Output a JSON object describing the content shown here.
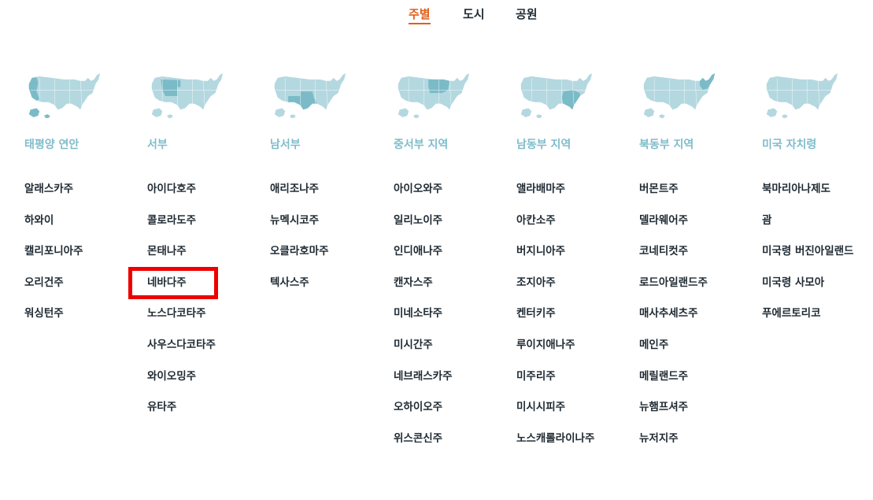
{
  "tabs": [
    {
      "label": "주별",
      "active": true
    },
    {
      "label": "도시",
      "active": false
    },
    {
      "label": "공원",
      "active": false
    }
  ],
  "colors": {
    "active_tab": "#e05f1a",
    "tab_text": "#1f2a33",
    "region_title": "#7fbccb",
    "map_base": "#b4d8e0",
    "map_highlight": "#7bbbc7",
    "selection_box": "#ee0000"
  },
  "regions": [
    {
      "title": "태평양 연안",
      "map_icon": "us-map-pacific-icon",
      "states": [
        "알래스카주",
        "하와이",
        "캘리포니아주",
        "오리건주",
        "워싱턴주"
      ]
    },
    {
      "title": "서부",
      "map_icon": "us-map-west-icon",
      "states": [
        "아이다호주",
        "콜로라도주",
        "몬태나주",
        "네바다주",
        "노스다코타주",
        "사우스다코타주",
        "와이오밍주",
        "유타주"
      ]
    },
    {
      "title": "남서부",
      "map_icon": "us-map-southwest-icon",
      "states": [
        "애리조나주",
        "뉴멕시코주",
        "오클라호마주",
        "텍사스주"
      ]
    },
    {
      "title": "중서부 지역",
      "map_icon": "us-map-midwest-icon",
      "states": [
        "아이오와주",
        "일리노이주",
        "인디애나주",
        "캔자스주",
        "미네소타주",
        "미시간주",
        "네브래스카주",
        "오하이오주",
        "위스콘신주"
      ]
    },
    {
      "title": "남동부 지역",
      "map_icon": "us-map-southeast-icon",
      "states": [
        "앨라배마주",
        "아칸소주",
        "버지니아주",
        "조지아주",
        "켄터키주",
        "루이지애나주",
        "미주리주",
        "미시시피주",
        "노스캐롤라이나주"
      ]
    },
    {
      "title": "북동부 지역",
      "map_icon": "us-map-northeast-icon",
      "states": [
        "버몬트주",
        "델라웨어주",
        "코네티컷주",
        "로드아일랜드주",
        "매사추세츠주",
        "메인주",
        "메릴랜드주",
        "뉴햄프셔주",
        "뉴저지주"
      ]
    },
    {
      "title": "미국 자치령",
      "map_icon": "us-map-territories-icon",
      "states": [
        "북마리아나제도",
        "괌",
        "미국령 버진아일랜드",
        "미국령 사모아",
        "푸에르토리코"
      ]
    }
  ],
  "selected": {
    "region_index": 1,
    "state_index": 3
  }
}
